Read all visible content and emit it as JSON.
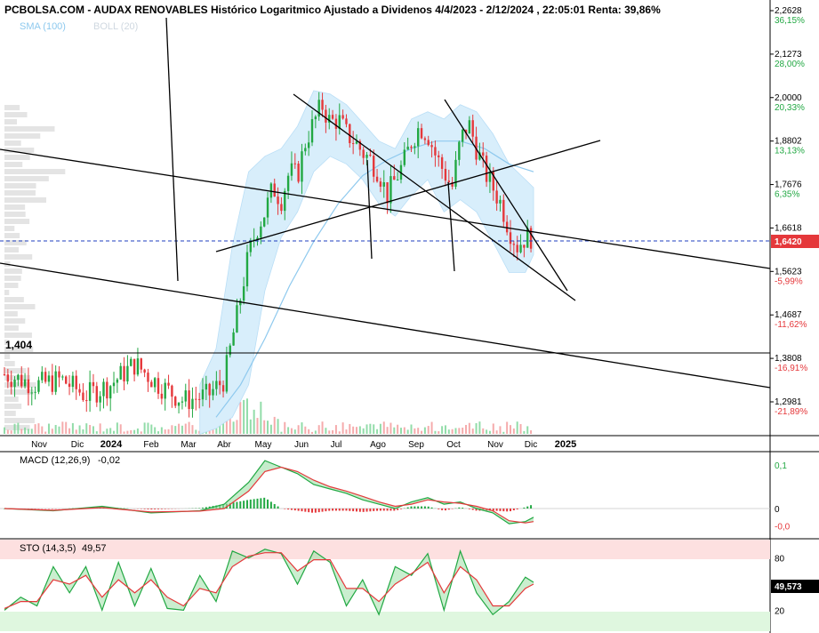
{
  "title": "PCBOLSA.COM - AUDAX RENOVABLES Histórico Logaritmico Ajustado a Dividenos 4/4/2023 - 2/12/2024 , 22:05:01 Renta: 39,86%",
  "legend": {
    "sma": "SMA (100)",
    "boll": "BOLL (20)"
  },
  "colors": {
    "up": "#22a843",
    "down": "#e5383b",
    "sma": "#8ec9ee",
    "band": "#d8eefb",
    "price_line": "#1f3fbf",
    "price_tag": "#e5383b"
  },
  "chart_data": [
    {
      "type": "candlestick",
      "name": "price",
      "y_scale": "log",
      "y_ticks": [
        {
          "value": "2,2628",
          "pct": "36,15%",
          "v": 2.2628,
          "pos": true
        },
        {
          "value": "2,1273",
          "pct": "28,00%",
          "v": 2.1273,
          "pos": true
        },
        {
          "value": "2,0000",
          "pct": "20,33%",
          "v": 2.0,
          "pos": true
        },
        {
          "value": "1,8802",
          "pct": "13,13%",
          "v": 1.8802,
          "pos": true
        },
        {
          "value": "1,7676",
          "pct": "6,35%",
          "v": 1.7676,
          "pos": true
        },
        {
          "value": "1,6618",
          "pct": "",
          "v": 1.6618,
          "pos": true
        },
        {
          "value": "1,5623",
          "pct": "-5,99%",
          "v": 1.5623,
          "pos": false
        },
        {
          "value": "1,4687",
          "pct": "-11,62%",
          "v": 1.4687,
          "pos": false
        },
        {
          "value": "1,3808",
          "pct": "-16,91%",
          "v": 1.3808,
          "pos": false
        },
        {
          "value": "1,2981",
          "pct": "-21,89%",
          "v": 1.2981,
          "pos": false
        }
      ],
      "last_price": "1,6420",
      "last_value": 1.642,
      "support_label": "1,404",
      "support_value": 1.404,
      "x_labels": [
        "Nov",
        "Dic",
        "2024",
        "Feb",
        "Mar",
        "Abr",
        "May",
        "Jun",
        "Jul",
        "Ago",
        "Sep",
        "Oct",
        "Nov",
        "Dic",
        "2025"
      ],
      "year_labels": [
        "2024",
        "2025"
      ],
      "close_path": [
        [
          0,
          1.35
        ],
        [
          4,
          1.33
        ],
        [
          7,
          1.34
        ],
        [
          10,
          1.31
        ],
        [
          13,
          1.33
        ],
        [
          16,
          1.37
        ],
        [
          19,
          1.33
        ],
        [
          22,
          1.3
        ],
        [
          25,
          1.31
        ],
        [
          27,
          1.34
        ],
        [
          28.5,
          1.46
        ],
        [
          30,
          1.6
        ],
        [
          31,
          1.66
        ],
        [
          32,
          1.7
        ],
        [
          33,
          1.76
        ],
        [
          34,
          1.73
        ],
        [
          35,
          1.8
        ],
        [
          36,
          1.79
        ],
        [
          37,
          1.88
        ],
        [
          38,
          1.93
        ],
        [
          39,
          1.98
        ],
        [
          40,
          1.93
        ],
        [
          41,
          1.94
        ],
        [
          42,
          1.9
        ],
        [
          43,
          1.88
        ],
        [
          44,
          1.85
        ],
        [
          45,
          1.83
        ],
        [
          46,
          1.8
        ],
        [
          47,
          1.74
        ],
        [
          48,
          1.78
        ],
        [
          49,
          1.82
        ],
        [
          50,
          1.88
        ],
        [
          51,
          1.92
        ],
        [
          52,
          1.9
        ],
        [
          53,
          1.84
        ],
        [
          54,
          1.8
        ],
        [
          55,
          1.76
        ],
        [
          56,
          1.88
        ],
        [
          57,
          1.93
        ],
        [
          58,
          1.86
        ],
        [
          59,
          1.8
        ],
        [
          60,
          1.76
        ],
        [
          61,
          1.72
        ],
        [
          62,
          1.66
        ],
        [
          63,
          1.62
        ],
        [
          64,
          1.64
        ],
        [
          65,
          1.642
        ]
      ],
      "sma_path": [
        [
          26,
          1.27
        ],
        [
          29,
          1.33
        ],
        [
          32,
          1.42
        ],
        [
          35,
          1.53
        ],
        [
          38,
          1.63
        ],
        [
          41,
          1.72
        ],
        [
          44,
          1.79
        ],
        [
          47,
          1.83
        ],
        [
          50,
          1.86
        ],
        [
          53,
          1.88
        ],
        [
          56,
          1.88
        ],
        [
          59,
          1.86
        ],
        [
          62,
          1.82
        ],
        [
          65,
          1.8
        ]
      ],
      "band_upper": [
        [
          24,
          1.33
        ],
        [
          26,
          1.4
        ],
        [
          28,
          1.62
        ],
        [
          30,
          1.8
        ],
        [
          32,
          1.84
        ],
        [
          34,
          1.86
        ],
        [
          36,
          1.92
        ],
        [
          38,
          2.02
        ],
        [
          40,
          2.01
        ],
        [
          42,
          1.98
        ],
        [
          44,
          1.93
        ],
        [
          46,
          1.88
        ],
        [
          48,
          1.86
        ],
        [
          50,
          1.94
        ],
        [
          52,
          1.96
        ],
        [
          54,
          1.94
        ],
        [
          56,
          1.98
        ],
        [
          58,
          1.96
        ],
        [
          60,
          1.9
        ],
        [
          62,
          1.82
        ],
        [
          64,
          1.78
        ],
        [
          65,
          1.76
        ]
      ],
      "band_lower": [
        [
          24,
          1.24
        ],
        [
          26,
          1.25
        ],
        [
          28,
          1.27
        ],
        [
          30,
          1.33
        ],
        [
          32,
          1.52
        ],
        [
          34,
          1.64
        ],
        [
          36,
          1.7
        ],
        [
          38,
          1.8
        ],
        [
          40,
          1.84
        ],
        [
          42,
          1.82
        ],
        [
          44,
          1.78
        ],
        [
          46,
          1.72
        ],
        [
          48,
          1.69
        ],
        [
          50,
          1.74
        ],
        [
          52,
          1.78
        ],
        [
          54,
          1.7
        ],
        [
          56,
          1.73
        ],
        [
          58,
          1.7
        ],
        [
          60,
          1.63
        ],
        [
          62,
          1.56
        ],
        [
          64,
          1.56
        ],
        [
          65,
          1.6
        ]
      ]
    },
    {
      "type": "line",
      "name": "MACD",
      "label": "MACD (12,26,9)",
      "current": "-0,02",
      "y_ticks": [
        {
          "label": "0,1",
          "v": 0.1,
          "pos": true
        },
        {
          "label": "0",
          "v": 0.0,
          "pos": null
        },
        {
          "label": "-0,0",
          "v": -0.04,
          "pos": false
        }
      ],
      "macd_path": [
        [
          0,
          0.0
        ],
        [
          6,
          -0.005
        ],
        [
          12,
          0.005
        ],
        [
          18,
          -0.01
        ],
        [
          24,
          -0.005
        ],
        [
          27,
          0.01
        ],
        [
          30,
          0.06
        ],
        [
          32,
          0.11
        ],
        [
          34,
          0.095
        ],
        [
          36,
          0.08
        ],
        [
          38,
          0.055
        ],
        [
          40,
          0.045
        ],
        [
          42,
          0.035
        ],
        [
          44,
          0.02
        ],
        [
          46,
          0.01
        ],
        [
          48,
          0.0
        ],
        [
          50,
          0.015
        ],
        [
          52,
          0.025
        ],
        [
          54,
          0.01
        ],
        [
          56,
          0.015
        ],
        [
          58,
          0.0
        ],
        [
          60,
          -0.01
        ],
        [
          62,
          -0.035
        ],
        [
          64,
          -0.03
        ],
        [
          65,
          -0.02
        ]
      ],
      "signal_path": [
        [
          0,
          0.0
        ],
        [
          6,
          -0.004
        ],
        [
          12,
          0.002
        ],
        [
          18,
          -0.008
        ],
        [
          24,
          -0.006
        ],
        [
          27,
          0.0
        ],
        [
          30,
          0.04
        ],
        [
          32,
          0.085
        ],
        [
          34,
          0.095
        ],
        [
          36,
          0.085
        ],
        [
          38,
          0.065
        ],
        [
          40,
          0.05
        ],
        [
          42,
          0.04
        ],
        [
          44,
          0.028
        ],
        [
          46,
          0.015
        ],
        [
          48,
          0.005
        ],
        [
          50,
          0.01
        ],
        [
          52,
          0.02
        ],
        [
          54,
          0.015
        ],
        [
          56,
          0.012
        ],
        [
          58,
          0.005
        ],
        [
          60,
          -0.005
        ],
        [
          62,
          -0.028
        ],
        [
          64,
          -0.033
        ],
        [
          65,
          -0.03
        ]
      ]
    },
    {
      "type": "line",
      "name": "STO",
      "label": "STO (14,3,5)",
      "current": "49,57",
      "last_value": "49,573",
      "y_ticks": [
        {
          "label": "80",
          "v": 80
        },
        {
          "label": "20",
          "v": 20
        }
      ],
      "k_path": [
        [
          0,
          20
        ],
        [
          2,
          35
        ],
        [
          4,
          25
        ],
        [
          6,
          70
        ],
        [
          8,
          40
        ],
        [
          10,
          70
        ],
        [
          12,
          20
        ],
        [
          14,
          75
        ],
        [
          16,
          25
        ],
        [
          18,
          68
        ],
        [
          20,
          22
        ],
        [
          22,
          20
        ],
        [
          24,
          60
        ],
        [
          26,
          30
        ],
        [
          28,
          88
        ],
        [
          30,
          80
        ],
        [
          32,
          90
        ],
        [
          34,
          85
        ],
        [
          36,
          50
        ],
        [
          38,
          88
        ],
        [
          40,
          75
        ],
        [
          42,
          25
        ],
        [
          44,
          55
        ],
        [
          46,
          15
        ],
        [
          48,
          70
        ],
        [
          50,
          60
        ],
        [
          52,
          85
        ],
        [
          54,
          20
        ],
        [
          56,
          88
        ],
        [
          58,
          40
        ],
        [
          60,
          15
        ],
        [
          62,
          30
        ],
        [
          64,
          58
        ],
        [
          65,
          52
        ]
      ],
      "d_path": [
        [
          0,
          22
        ],
        [
          2,
          30
        ],
        [
          4,
          30
        ],
        [
          6,
          55
        ],
        [
          8,
          50
        ],
        [
          10,
          60
        ],
        [
          12,
          35
        ],
        [
          14,
          55
        ],
        [
          16,
          40
        ],
        [
          18,
          55
        ],
        [
          20,
          35
        ],
        [
          22,
          25
        ],
        [
          24,
          45
        ],
        [
          26,
          40
        ],
        [
          28,
          70
        ],
        [
          30,
          82
        ],
        [
          32,
          86
        ],
        [
          34,
          86
        ],
        [
          36,
          65
        ],
        [
          38,
          78
        ],
        [
          40,
          78
        ],
        [
          42,
          45
        ],
        [
          44,
          45
        ],
        [
          46,
          30
        ],
        [
          48,
          50
        ],
        [
          50,
          62
        ],
        [
          52,
          75
        ],
        [
          54,
          40
        ],
        [
          56,
          70
        ],
        [
          58,
          55
        ],
        [
          60,
          25
        ],
        [
          62,
          25
        ],
        [
          64,
          45
        ],
        [
          65,
          50
        ]
      ]
    }
  ]
}
